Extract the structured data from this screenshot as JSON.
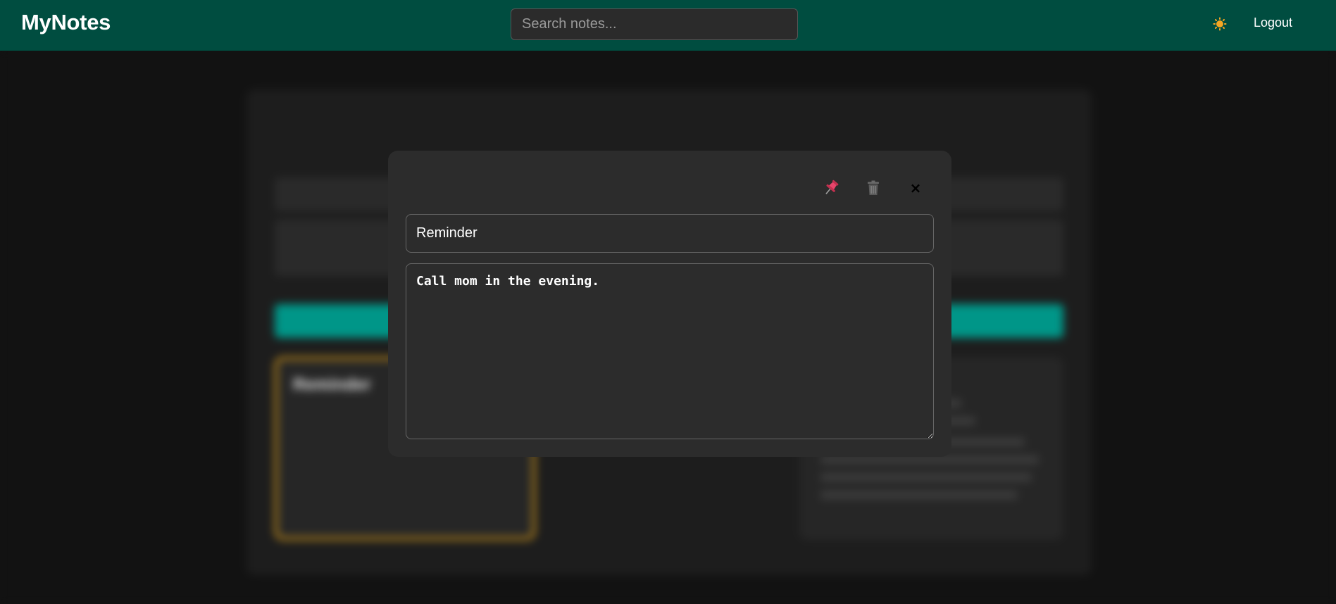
{
  "header": {
    "brand": "MyNotes",
    "search_placeholder": "Search notes...",
    "theme_icon": "sun-icon",
    "logout_label": "Logout"
  },
  "background": {
    "note_title": "Reminder"
  },
  "modal": {
    "pin_icon": "pin-icon",
    "delete_icon": "trash-icon",
    "close_label": "×",
    "title_value": "Reminder",
    "content_value": "Call mom in the evening."
  },
  "colors": {
    "header_bg": "#004d40",
    "accent_teal": "#009688",
    "pin_color": "#e8456b",
    "sun_color": "#f5a623",
    "pinned_border": "#d89a18"
  }
}
